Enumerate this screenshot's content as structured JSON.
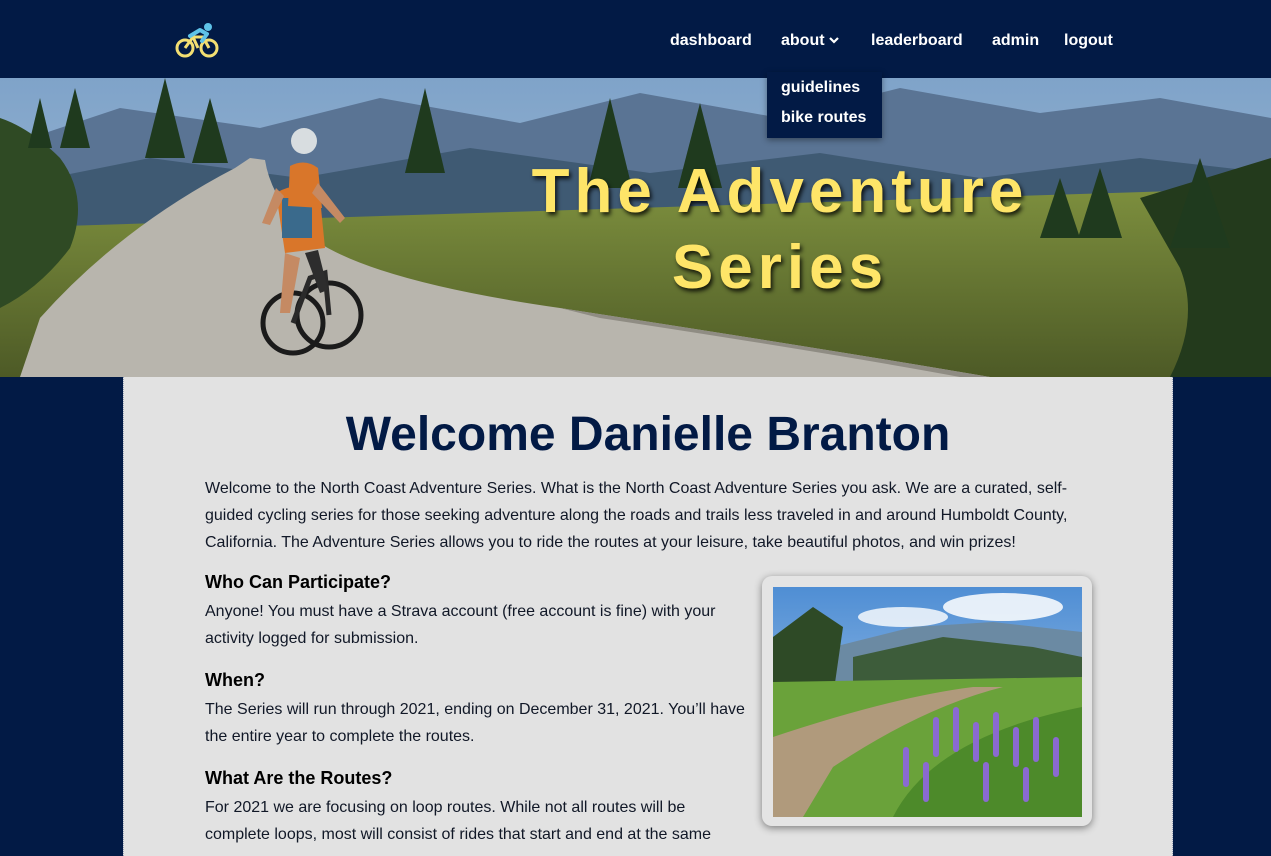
{
  "nav": {
    "logo_icon": "cyclist-icon",
    "links": [
      {
        "label": "dashboard"
      },
      {
        "label": "about"
      },
      {
        "label": "leaderboard"
      },
      {
        "label": "admin"
      },
      {
        "label": "logout"
      }
    ],
    "about_dropdown": [
      "guidelines",
      "bike routes"
    ]
  },
  "hero": {
    "title_line1": "The Adventure",
    "title_line2": "Series"
  },
  "main": {
    "welcome": "Welcome Danielle Branton",
    "intro": "Welcome to the North Coast Adventure Series. What is the North Coast Adventure Series you ask. We are a curated, self-guided cycling series for those seeking adventure along the roads and trails less traveled in and around Humboldt County, California. The Adventure Series allows you to ride the routes at your leisure, take beautiful photos, and win prizes!",
    "sections": [
      {
        "heading": "Who Can Participate?",
        "text": "Anyone! You must have a Strava account (free account is fine) with your activity logged for submission."
      },
      {
        "heading": "When?",
        "text": "The Series will run through 2021, ending on December 31, 2021. You’ll have the entire year to complete the routes."
      },
      {
        "heading": "What Are the Routes?",
        "text": "For 2021 we are focusing on loop routes. While not all routes will be complete loops, most will consist of rides that start and end at the same"
      }
    ]
  },
  "colors": {
    "navy": "#021a45",
    "title_yellow": "#fee568",
    "panel_gray": "#e2e2e2"
  }
}
